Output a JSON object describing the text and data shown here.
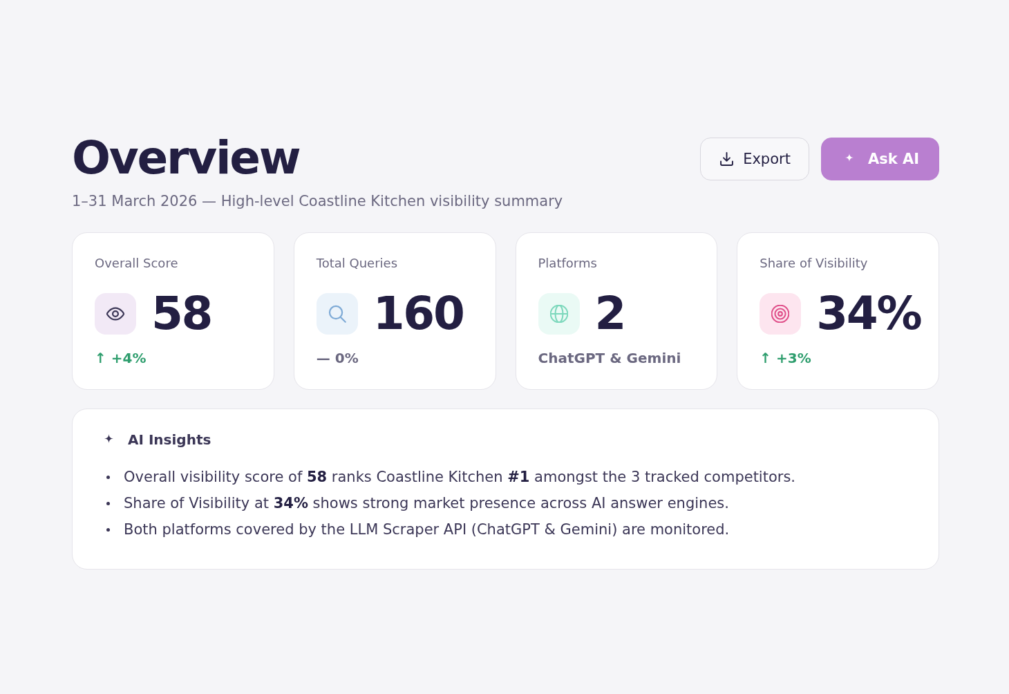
{
  "header": {
    "title": "Overview",
    "subtitle": "1–31 March 2026 — High-level Coastline Kitchen visibility summary"
  },
  "actions": [
    {
      "label": "Export",
      "kind": "secondary"
    },
    {
      "label": "Ask AI",
      "kind": "primary"
    }
  ],
  "metrics": [
    {
      "label": "Overall Score",
      "value": "58",
      "color": "#f2e9f6",
      "footer": {
        "kind": "up",
        "text": "↑ +4%"
      }
    },
    {
      "label": "Total Queries",
      "value": "160",
      "color": "#ebf3fa",
      "footer": {
        "kind": "flat",
        "text": "— 0%"
      }
    },
    {
      "label": "Platforms",
      "value": "2",
      "color": "#eafaf5",
      "footer": {
        "kind": "note",
        "text": "ChatGPT & Gemini"
      }
    },
    {
      "label": "Share of Visibility",
      "value": "34%",
      "color": "#fde5ef",
      "footer": {
        "kind": "up",
        "text": "↑ +3%"
      }
    }
  ],
  "insights": {
    "title": "AI Insights",
    "items": [
      "Overall visibility score of **58** ranks Coastline Kitchen **#1** amongst the 3 tracked competitors.",
      "Share of Visibility at **34%** shows strong market presence across AI answer engines.",
      "Both platforms covered by the LLM Scraper API (ChatGPT & Gemini) are monitored."
    ]
  }
}
